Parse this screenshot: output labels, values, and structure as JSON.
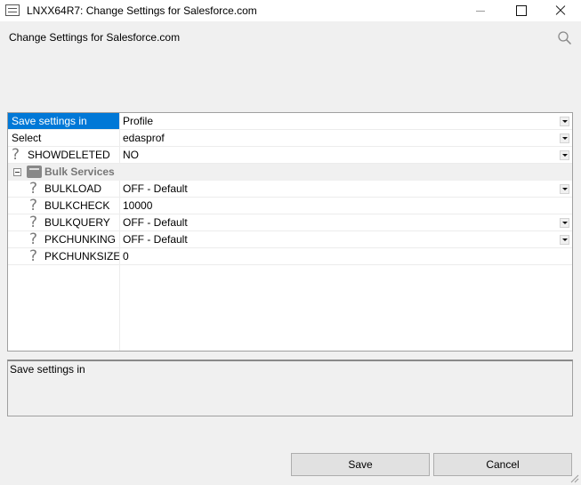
{
  "window": {
    "title": "LNXX64R7: Change Settings for Salesforce.com"
  },
  "header": {
    "title": "Change Settings for Salesforce.com",
    "search_icon": "search-icon"
  },
  "grid": {
    "rows": [
      {
        "name": "Save settings in",
        "value": "Profile",
        "dropdown": true,
        "selected": true
      },
      {
        "name": "Select",
        "value": "edasprof",
        "dropdown": true
      },
      {
        "name": "SHOWDELETED",
        "value": "NO",
        "dropdown": true,
        "help": true
      }
    ],
    "category": {
      "label": "Bulk Services",
      "expanded": true
    },
    "bulk_rows": [
      {
        "name": "BULKLOAD",
        "value": "OFF - Default",
        "dropdown": true
      },
      {
        "name": "BULKCHECK",
        "value": "10000",
        "dropdown": false
      },
      {
        "name": "BULKQUERY",
        "value": "OFF - Default",
        "dropdown": true
      },
      {
        "name": "PKCHUNKING",
        "value": "OFF - Default",
        "dropdown": true
      },
      {
        "name": "PKCHUNKSIZE",
        "value": "0",
        "dropdown": false
      }
    ],
    "help_glyph": "?"
  },
  "description": {
    "text": "Save settings in"
  },
  "buttons": {
    "save": "Save",
    "cancel": "Cancel"
  },
  "colors": {
    "selection": "#0078d7",
    "background": "#f0f0f0"
  }
}
